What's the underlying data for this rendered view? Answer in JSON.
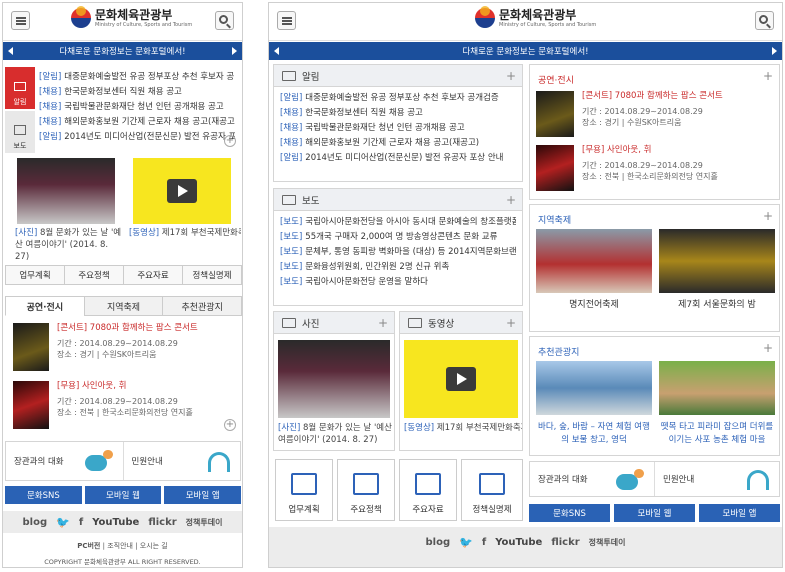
{
  "brand": {
    "name": "문화체육관광부",
    "sub": "Ministry of Culture, Sports and Tourism"
  },
  "banner_text": "다채로운 문화정보는 문화포털에서!",
  "notice": {
    "title": "알림",
    "items": [
      {
        "tag": "[알림]",
        "text": "대중문화예술발전 유공 정부포상 추천 후보자 공개검증"
      },
      {
        "tag": "[채용]",
        "text": "한국문화정보센터 직원 채용 공고"
      },
      {
        "tag": "[채용]",
        "text": "국립박물관문화재단 청년 인턴 공개채용 공고"
      },
      {
        "tag": "[채용]",
        "text": "해외문화홍보원 기간제 근로자 채용 공고(재공고)"
      },
      {
        "tag": "[알림]",
        "text": "2014년도 미디어산업(전문신문) 발전 유공자 포상 안내"
      }
    ]
  },
  "mobile_notice": [
    {
      "tag": "[알림]",
      "text": "대중문화예술발전 유공 정부포상 추천 후보자 공..."
    },
    {
      "tag": "[채용]",
      "text": "한국문화정보센터 직원 채용 공고"
    },
    {
      "tag": "[채용]",
      "text": "국립박물관문화재단 청년 인턴 공개채용 공고"
    },
    {
      "tag": "[채용]",
      "text": "해외문화홍보원 기간제 근로자 채용 공고(재공고)"
    },
    {
      "tag": "[알림]",
      "text": "2014년도 미디어산업(전문신문) 발전 유공자 포..."
    }
  ],
  "side_tabs": {
    "notice": "알림",
    "press": "보도"
  },
  "press": {
    "title": "보도",
    "items": [
      {
        "tag": "[보도]",
        "text": "국립아시아문화전당을 아시아 동시대 문화예술의 창조플랫폼..."
      },
      {
        "tag": "[보도]",
        "text": "55개국 구매자 2,000여 명 방송영상콘텐츠 문화 교류"
      },
      {
        "tag": "[보도]",
        "text": "문체부, 통영 동피랑 벽화마을 (대상) 등 2014지역문화브랜드..."
      },
      {
        "tag": "[보도]",
        "text": "문화융성위원회, 민간위원 2명 신규 위촉"
      },
      {
        "tag": "[보도]",
        "text": "국립아시아문화전당 운영을 말하다"
      }
    ]
  },
  "photo": {
    "title": "사진",
    "tag": "[사진]",
    "text": "8월 문화가 있는 날 '예산 여름이야기' (2014. 8. 27)"
  },
  "video": {
    "title": "동영상",
    "tag": "[동영상]",
    "text": "제17회 부천국제만화축제"
  },
  "mobile_video_text": "제17회 부천국제만화축제",
  "quick": [
    "업무계획",
    "주요정책",
    "주요자료",
    "정책실명제"
  ],
  "tabs": [
    "공연·전시",
    "지역축제",
    "추천관광지"
  ],
  "events": [
    {
      "title": "[콘서트] 7080과 함께하는 팝스 콘서트",
      "period": "기간 : 2014.08.29~2014.08.29",
      "place": "장소 : 경기 | 수원SK아트리움"
    },
    {
      "title": "[무용] 사인아웃, 휘",
      "period": "기간 : 2014.08.29~2014.08.29",
      "place": "장소 : 전북 | 한국소리문화의전당 연지홀"
    }
  ],
  "performance_title": "공연·전시",
  "festival": {
    "title": "지역축제",
    "items": [
      "명지전어축제",
      "제7회 서울문화의 밤"
    ]
  },
  "tour": {
    "title": "추천관광지",
    "items": [
      "바다, 숲, 바람 – 자연 체험 여행의 보물 창고, 영덕",
      "뗏목 타고 피라미 잡으며 더위를 이기는 사포 농촌 체험 마을"
    ]
  },
  "help": {
    "minister": "장관과의 대화",
    "civil": "민원안내"
  },
  "blue_buttons": [
    "문화SNS",
    "모바일 웹",
    "모바일 앱"
  ],
  "social": [
    "blog",
    "t",
    "f",
    "YouTube",
    "flickr",
    "정책투데이"
  ],
  "footer_links": [
    "PC버전",
    "조직안내",
    "오시는 길"
  ],
  "copyright": "COPYRIGHT 문화체육관광부 ALL RIGHT RESERVED."
}
